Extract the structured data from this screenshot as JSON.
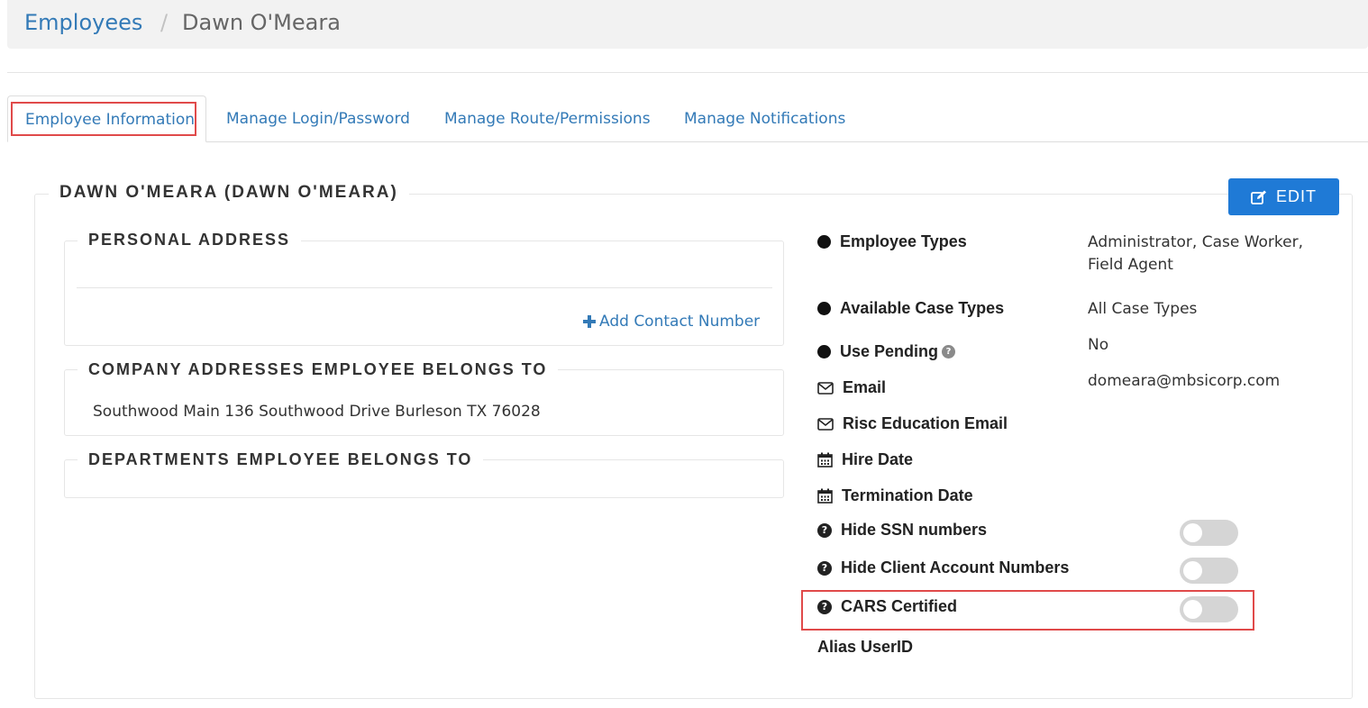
{
  "breadcrumb": {
    "parent": "Employees",
    "separator": "/",
    "current": "Dawn O'Meara"
  },
  "tabs": [
    {
      "label": "Employee Information",
      "active": true
    },
    {
      "label": "Manage Login/Password",
      "active": false
    },
    {
      "label": "Manage Route/Permissions",
      "active": false
    },
    {
      "label": "Manage Notifications",
      "active": false
    }
  ],
  "panel": {
    "title": "DAWN O'MEARA (DAWN O'MEARA)",
    "edit_label": "EDIT"
  },
  "personal_address": {
    "title": "PERSONAL ADDRESS",
    "add_contact_label": "Add Contact Number"
  },
  "company_addresses": {
    "title": "COMPANY ADDRESSES EMPLOYEE BELONGS TO",
    "address": "Southwood Main 136 Southwood Drive Burleson TX 76028"
  },
  "departments": {
    "title": "DEPARTMENTS EMPLOYEE BELONGS TO"
  },
  "details": {
    "employee_types": {
      "label": "Employee Types",
      "value_line1": "Administrator, Case Worker,",
      "value_line2": "Field Agent"
    },
    "available_case_types": {
      "label": "Available Case Types",
      "value": "All Case Types"
    },
    "use_pending": {
      "label": "Use Pending",
      "value": "No"
    },
    "email": {
      "label": "Email",
      "value": "domeara@mbsicorp.com"
    },
    "risc_email": {
      "label": "Risc Education Email",
      "value": ""
    },
    "hire_date": {
      "label": "Hire Date",
      "value": ""
    },
    "termination_date": {
      "label": "Termination Date",
      "value": ""
    },
    "hide_ssn": {
      "label": "Hide SSN numbers",
      "enabled": false
    },
    "hide_client_account": {
      "label": "Hide Client Account Numbers",
      "enabled": false
    },
    "cars_certified": {
      "label": "CARS Certified",
      "enabled": false
    },
    "alias_userid": {
      "label": "Alias UserID",
      "value": ""
    }
  },
  "colors": {
    "link": "#337ab7",
    "primary_button": "#1f7ad6",
    "highlight": "#e04a4a",
    "toggle_off": "#d5d5d5"
  },
  "icons": {
    "edit": "edit-icon",
    "plus": "plus-icon",
    "bullet": "bullet-icon",
    "envelope": "envelope-icon",
    "calendar": "calendar-icon",
    "question": "question-circle-icon"
  }
}
